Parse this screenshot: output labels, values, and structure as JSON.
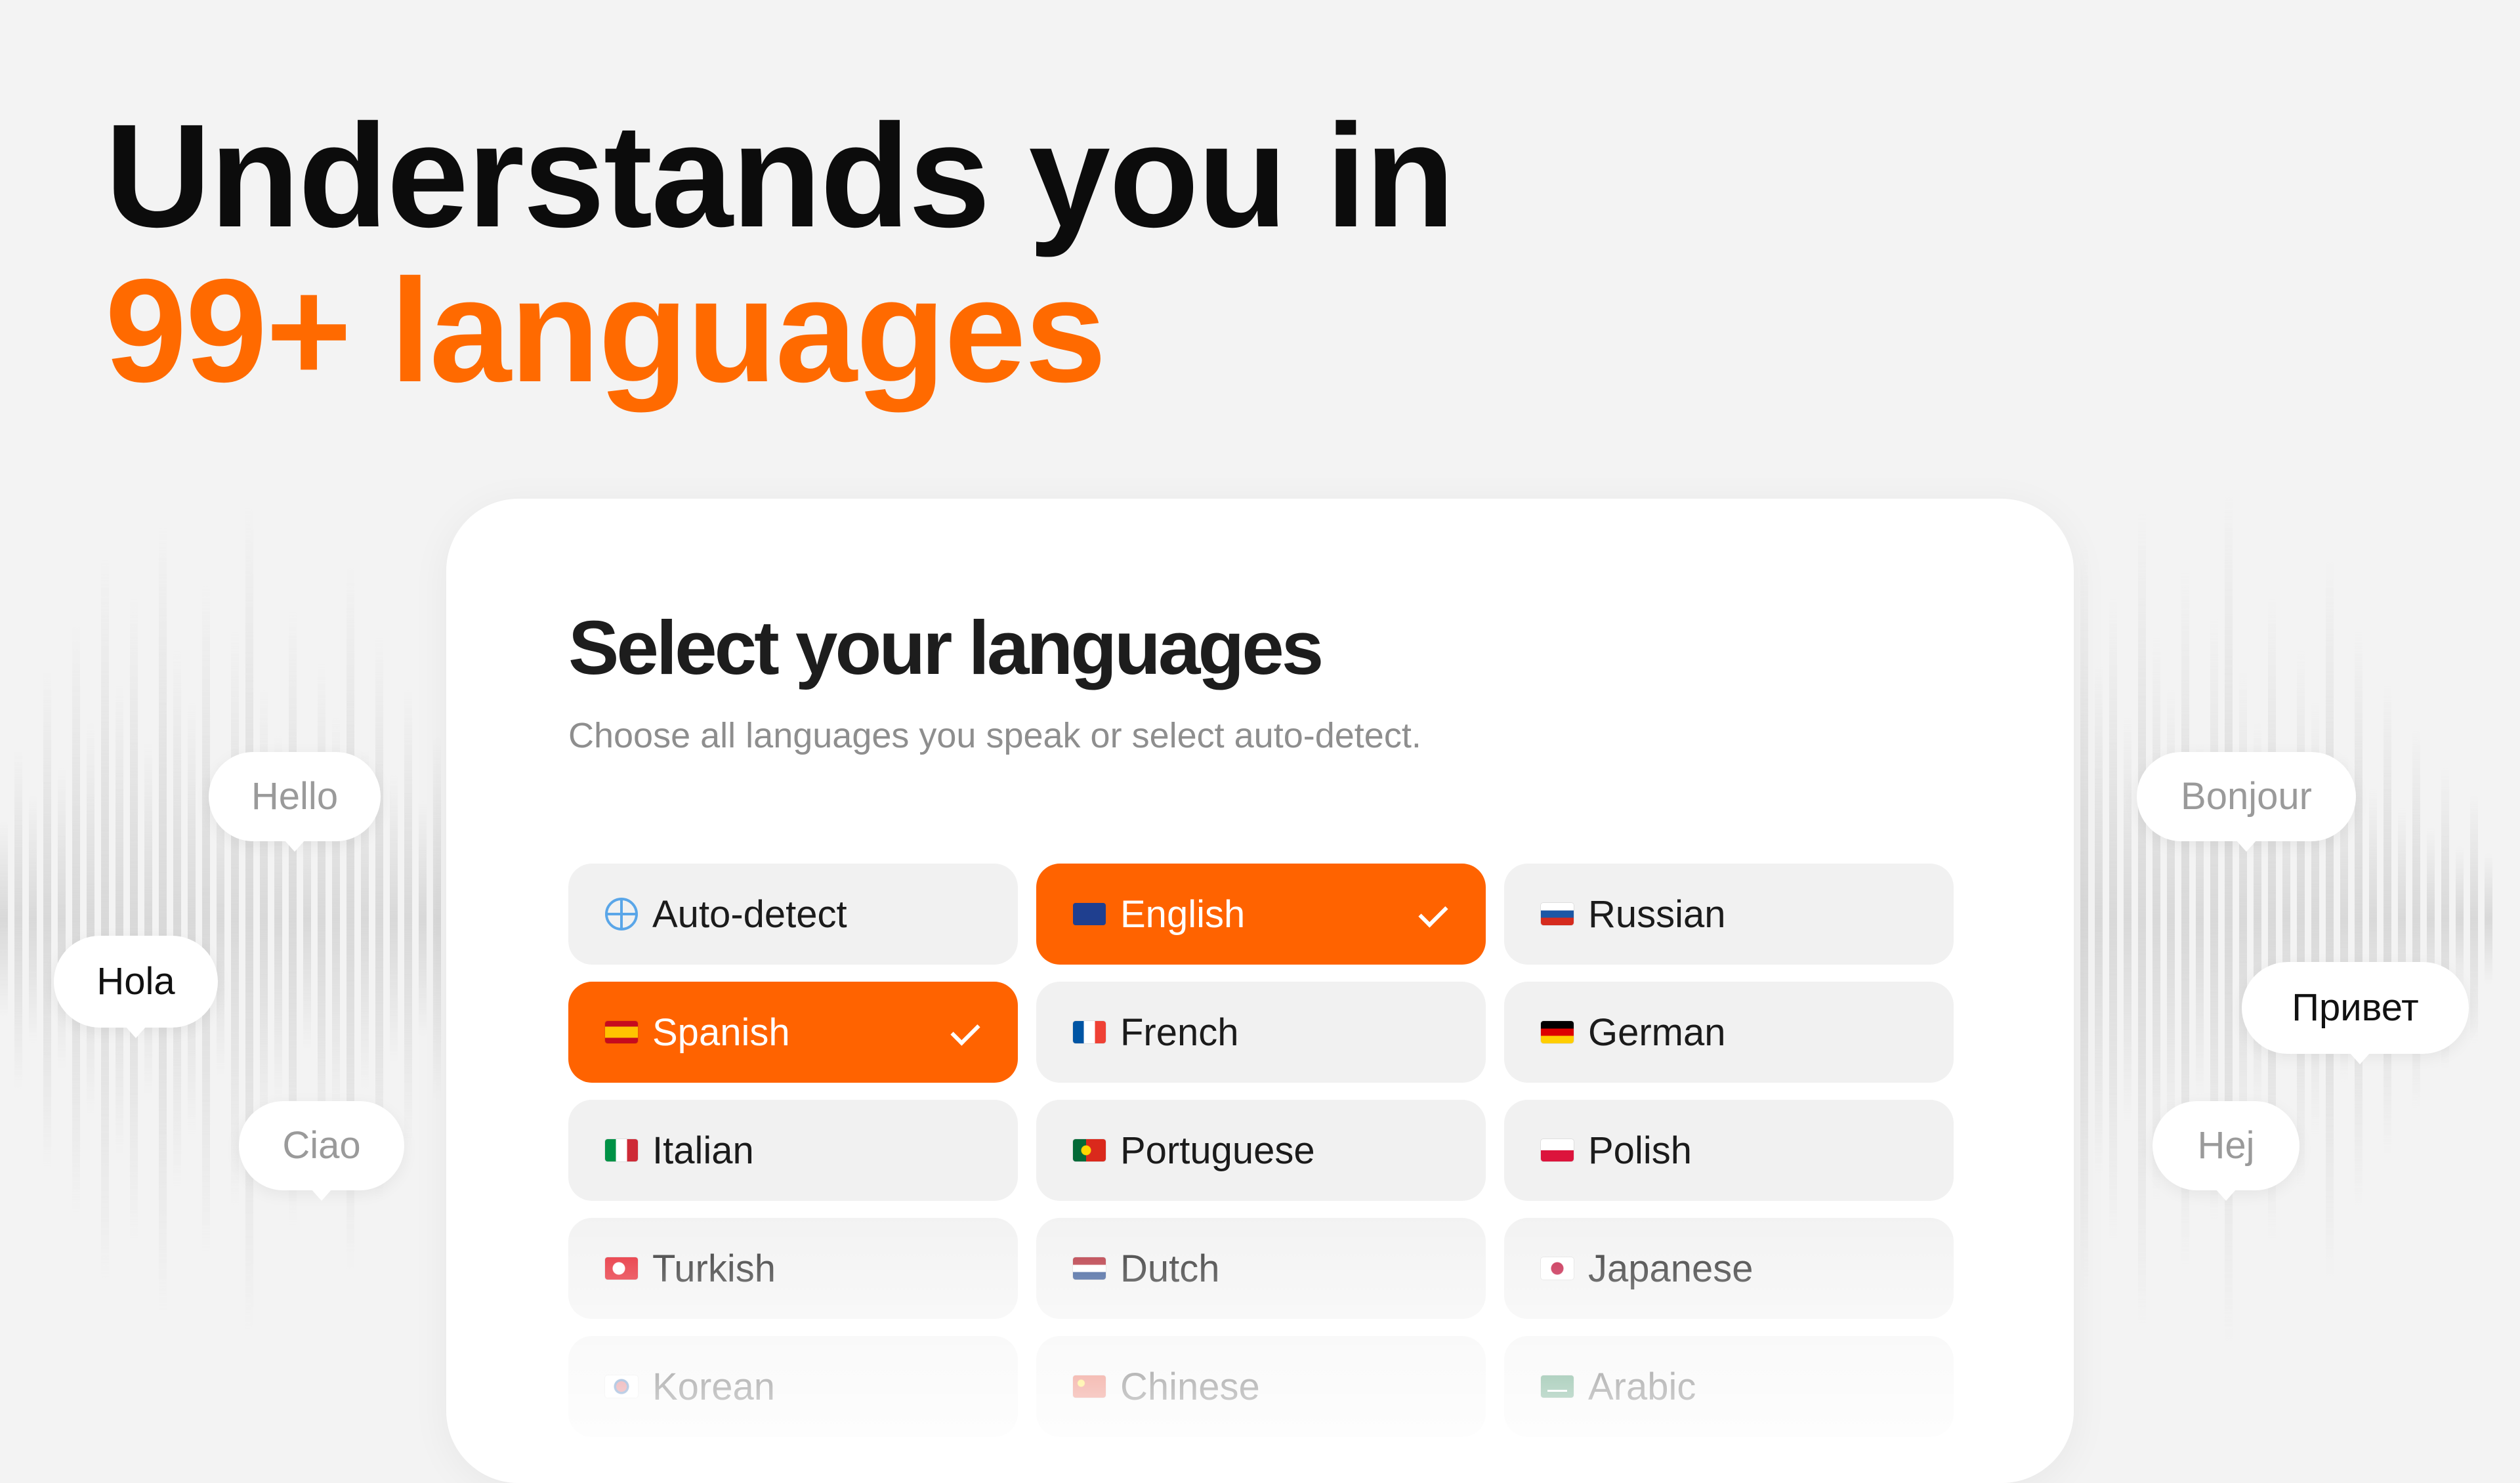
{
  "hero": {
    "line1": "Understands you in",
    "line2": "99+ languages"
  },
  "card": {
    "title": "Select your languages",
    "subtitle": "Choose all languages you speak or select auto-detect."
  },
  "languages": [
    {
      "label": "Auto-detect",
      "icon": "globe-icon",
      "selected": false
    },
    {
      "label": "English",
      "icon": "flag-uk-icon",
      "selected": true
    },
    {
      "label": "Russian",
      "icon": "flag-russia-icon",
      "selected": false
    },
    {
      "label": "Spanish",
      "icon": "flag-spain-icon",
      "selected": true
    },
    {
      "label": "French",
      "icon": "flag-france-icon",
      "selected": false
    },
    {
      "label": "German",
      "icon": "flag-germany-icon",
      "selected": false
    },
    {
      "label": "Italian",
      "icon": "flag-italy-icon",
      "selected": false
    },
    {
      "label": "Portuguese",
      "icon": "flag-portugal-icon",
      "selected": false
    },
    {
      "label": "Polish",
      "icon": "flag-poland-icon",
      "selected": false
    },
    {
      "label": "Turkish",
      "icon": "flag-turkey-icon",
      "selected": false
    },
    {
      "label": "Dutch",
      "icon": "flag-netherlands-icon",
      "selected": false
    },
    {
      "label": "Japanese",
      "icon": "flag-japan-icon",
      "selected": false
    },
    {
      "label": "Korean",
      "icon": "flag-korea-icon",
      "selected": false
    },
    {
      "label": "Chinese",
      "icon": "flag-china-icon",
      "selected": false
    },
    {
      "label": "Arabic",
      "icon": "flag-saudi-icon",
      "selected": false
    }
  ],
  "greetings": {
    "hello": "Hello",
    "hola": "Hola",
    "ciao": "Ciao",
    "bonjour": "Bonjour",
    "privet": "Привет",
    "hej": "Hej"
  },
  "colors": {
    "accent": "#ff6300",
    "chip_bg": "#f1f1f1",
    "background": "#f3f3f3"
  }
}
